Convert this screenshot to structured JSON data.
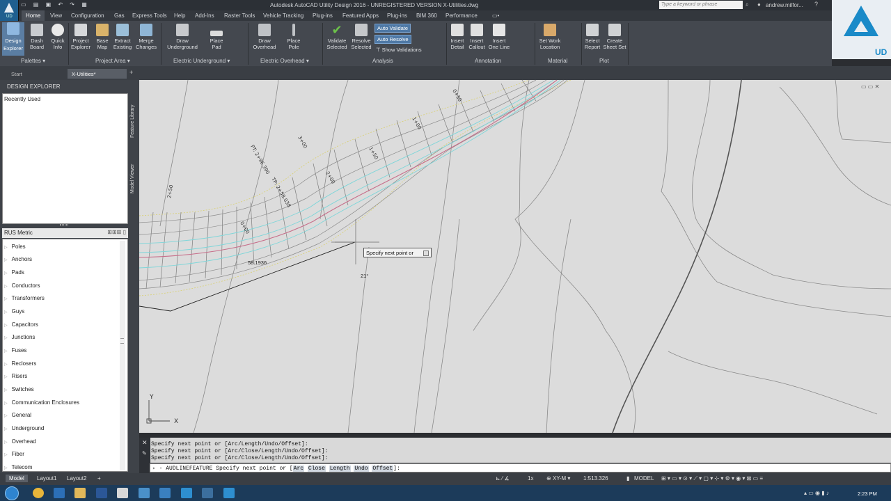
{
  "window": {
    "title": "Autodesk AutoCAD Utility Design 2016 - UNREGISTERED VERSION   X-Utilities.dwg",
    "search_placeholder": "Type a keyword or phrase",
    "user": "andrew.milfor...",
    "qat_icons": [
      "new-icon",
      "open-icon",
      "save-icon",
      "undo-icon",
      "redo-icon",
      "print-icon"
    ]
  },
  "product_badge": "UD",
  "ribbon_tabs": [
    "Home",
    "View",
    "Configuration",
    "Gas",
    "Express Tools",
    "Help",
    "Add-Ins",
    "Raster Tools",
    "Vehicle Tracking",
    "Plug-ins",
    "Featured Apps",
    "Plug-ins",
    "BIM 360",
    "Performance"
  ],
  "ribbon": {
    "buttons": [
      {
        "name": "design-explorer-button",
        "label": "Design\nExplorer",
        "icon": "design-explorer-icon"
      },
      {
        "name": "dashboard-button",
        "label": "Dash\nBoard",
        "icon": "dashboard-icon"
      },
      {
        "name": "quick-info-button",
        "label": "Quick\nInfo",
        "icon": "info-icon"
      },
      {
        "name": "project-explorer-button",
        "label": "Project\nExplorer",
        "icon": "project-explorer-icon"
      },
      {
        "name": "base-map-button",
        "label": "Base\nMap",
        "icon": "map-icon"
      },
      {
        "name": "extract-existing-button",
        "label": "Extract\nExisting",
        "icon": "extract-icon"
      },
      {
        "name": "merge-changes-button",
        "label": "Merge\nChanges",
        "icon": "merge-icon"
      },
      {
        "name": "draw-underground-button",
        "label": "Draw\nUnderground",
        "icon": "underground-icon"
      },
      {
        "name": "place-pad-button",
        "label": "Place\nPad",
        "icon": "pad-icon"
      },
      {
        "name": "draw-overhead-button",
        "label": "Draw\nOverhead",
        "icon": "overhead-icon"
      },
      {
        "name": "place-pole-button",
        "label": "Place\nPole",
        "icon": "pole-icon"
      },
      {
        "name": "validate-selected-button",
        "label": "Validate\nSelected",
        "icon": "checkmark-icon"
      },
      {
        "name": "resolve-selected-button",
        "label": "Resolve\nSelected",
        "icon": "resolve-icon"
      },
      {
        "name": "insert-detail-button",
        "label": "Insert\nDetail",
        "icon": "detail-icon"
      },
      {
        "name": "insert-callout-button",
        "label": "Insert\nCallout",
        "icon": "callout-icon"
      },
      {
        "name": "insert-one-line-button",
        "label": "Insert\nOne Line",
        "icon": "one-line-icon"
      },
      {
        "name": "set-work-location-button",
        "label": "Set Work\nLocation",
        "icon": "work-location-icon"
      },
      {
        "name": "select-report-button",
        "label": "Select\nReport",
        "icon": "report-icon"
      },
      {
        "name": "create-sheet-set-button",
        "label": "Create\nSheet Set",
        "icon": "sheet-set-icon"
      }
    ],
    "auto_validate": "Auto Validate",
    "auto_resolve": "Auto Resolve",
    "show_validations": "Show Validations",
    "panels": [
      "Palettes",
      "Project Area",
      "Electric Underground",
      "Electric Overhead",
      "Analysis",
      "Annotation",
      "Material",
      "Plot"
    ]
  },
  "doc_tabs": [
    "Start",
    "X-Utilities*"
  ],
  "palette": {
    "title": "DESIGN EXPLORER",
    "recent_label": "Recently Used",
    "side_tabs": [
      "Feature Library",
      "Model Viewer"
    ],
    "library_name": "RUS Metric",
    "categories": [
      "Poles",
      "Anchors",
      "Pads",
      "Conductors",
      "Transformers",
      "Guys",
      "Capacitors",
      "Junctions",
      "Fuses",
      "Reclosers",
      "Risers",
      "Switches",
      "Communication Enclosures",
      "General",
      "Underground",
      "Overhead",
      "Fiber",
      "Telecom"
    ]
  },
  "drawing": {
    "tooltip": "Specify next point or",
    "angle": "21°",
    "length": "58.1936",
    "station_labels": [
      "2+50",
      "3+00",
      "PT: 2+96.390",
      "TP: 2+58.038",
      "2+00",
      "1+50",
      "1+00",
      "0+50",
      "0+00"
    ]
  },
  "command": {
    "history": [
      "Specify next point or [Arc/Length/Undo/Offset]:",
      "Specify next point or [Arc/Close/Length/Undo/Offset]:",
      "Specify next point or [Arc/Close/Length/Undo/Offset]:"
    ],
    "prompt_prefix": "- AUDLINEFEATURE Specify next point or [",
    "options": [
      "Arc",
      "Close",
      "Length",
      "Undo",
      "Offset"
    ],
    "prompt_suffix": "]:"
  },
  "status": {
    "layouts": [
      "Model",
      "Layout1",
      "Layout2"
    ],
    "scale_factor": "1x",
    "ucs": "XY-M",
    "scale": "1:513.326",
    "space": "MODEL"
  },
  "taskbar": {
    "time": "2:23 PM",
    "apps": [
      "chrome-icon",
      "outlook-icon",
      "folder-icon",
      "word-icon",
      "file-icon",
      "ud-icon",
      "settings-icon",
      "autocad-icon",
      "c-icon",
      "autocad-icon"
    ]
  }
}
